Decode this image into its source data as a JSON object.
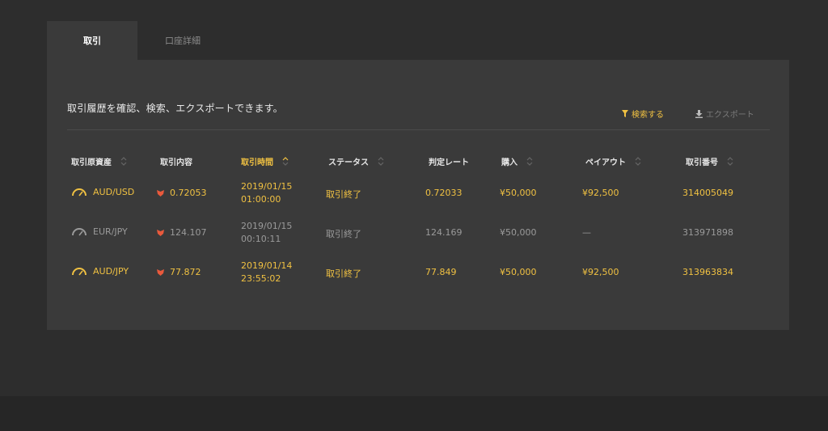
{
  "tabs": [
    {
      "label": "取引",
      "active": true
    },
    {
      "label": "口座詳細",
      "active": false
    }
  ],
  "description": "取引履歴を確認、検索、エクスポートできます。",
  "actions": {
    "search": "検索する",
    "export": "エクスポート"
  },
  "colors": {
    "accent": "#f0c142",
    "down": "#e8593c",
    "muted": "#9a9a9a",
    "panel": "#3a3a3a",
    "background": "#2d2d2d"
  },
  "columns": [
    {
      "label": "取引原資産",
      "sortable": true,
      "active": false
    },
    {
      "label": "取引内容",
      "sortable": false,
      "active": false
    },
    {
      "label": "取引時間",
      "sortable": true,
      "active": true
    },
    {
      "label": "ステータス",
      "sortable": true,
      "active": false
    },
    {
      "label": "判定レート",
      "sortable": false,
      "active": false
    },
    {
      "label": "購入",
      "sortable": true,
      "active": false
    },
    {
      "label": "ペイアウト",
      "sortable": true,
      "active": false
    },
    {
      "label": "取引番号",
      "sortable": true,
      "active": false
    }
  ],
  "rows": [
    {
      "asset": "AUD/USD",
      "direction_icon": "down-icon",
      "content": "0.72053",
      "date": "2019/01/15",
      "time": "01:00:00",
      "status": "取引終了",
      "rate": "0.72033",
      "purchase": "¥50,000",
      "payout": "¥92,500",
      "trade_no": "314005049",
      "highlight": true
    },
    {
      "asset": "EUR/JPY",
      "direction_icon": "down-icon",
      "content": "124.107",
      "date": "2019/01/15",
      "time": "00:10:11",
      "status": "取引終了",
      "rate": "124.169",
      "purchase": "¥50,000",
      "payout": "—",
      "trade_no": "313971898",
      "highlight": false
    },
    {
      "asset": "AUD/JPY",
      "direction_icon": "down-icon",
      "content": "77.872",
      "date": "2019/01/14",
      "time": "23:55:02",
      "status": "取引終了",
      "rate": "77.849",
      "purchase": "¥50,000",
      "payout": "¥92,500",
      "trade_no": "313963834",
      "highlight": true
    }
  ]
}
